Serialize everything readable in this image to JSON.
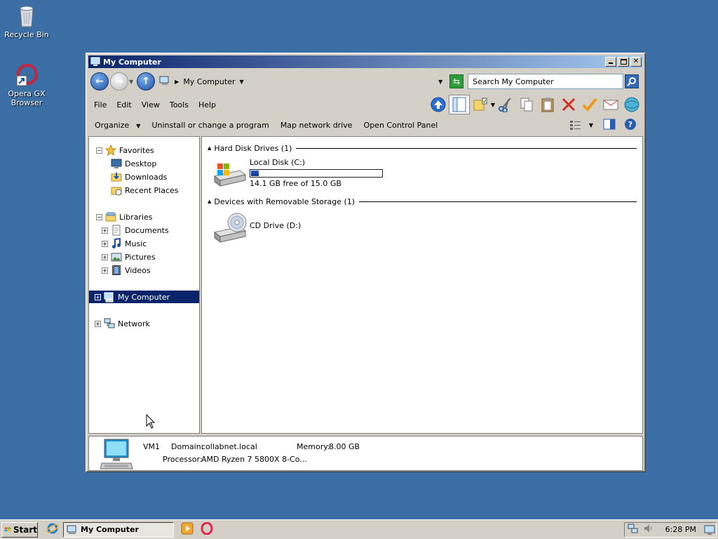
{
  "desktop": {
    "icons": [
      {
        "label": "Recycle Bin",
        "icon": "recycle-bin-icon"
      },
      {
        "label": "Opera GX Browser",
        "icon": "opera-gx-icon"
      }
    ]
  },
  "window": {
    "title": "My Computer",
    "address": {
      "path": "My Computer",
      "search_placeholder": "Search My Computer"
    },
    "menu": [
      "File",
      "Edit",
      "View",
      "Tools",
      "Help"
    ],
    "commands": {
      "organize": "Organize",
      "uninstall": "Uninstall or change a program",
      "map_drive": "Map network drive",
      "control_panel": "Open Control Panel"
    },
    "nav": {
      "favorites": {
        "label": "Favorites",
        "items": [
          "Desktop",
          "Downloads",
          "Recent Places"
        ]
      },
      "libraries": {
        "label": "Libraries",
        "items": [
          "Documents",
          "Music",
          "Pictures",
          "Videos"
        ]
      },
      "my_computer": "My Computer",
      "network": "Network"
    },
    "content": {
      "hdd_group": "Hard Disk Drives (1)",
      "removable_group": "Devices with Removable Storage (1)",
      "drive_c": {
        "name": "Local Disk (C:)",
        "free_text": "14.1 GB free of 15.0 GB",
        "used_fraction": 0.06
      },
      "drive_d": {
        "name": "CD Drive (D:)"
      }
    },
    "details": {
      "name": "VM1",
      "domain_label": "Domain:",
      "domain": "collabnet.local",
      "memory_label": "Memory:",
      "memory": "8.00 GB",
      "processor_label": "Processor:",
      "processor": "AMD Ryzen 7 5800X 8-Co..."
    }
  },
  "taskbar": {
    "start": "Start",
    "task": "My Computer",
    "clock": "6:28 PM"
  },
  "colors": {
    "desktop": "#3a6ea5",
    "selection": "#0a246a"
  }
}
